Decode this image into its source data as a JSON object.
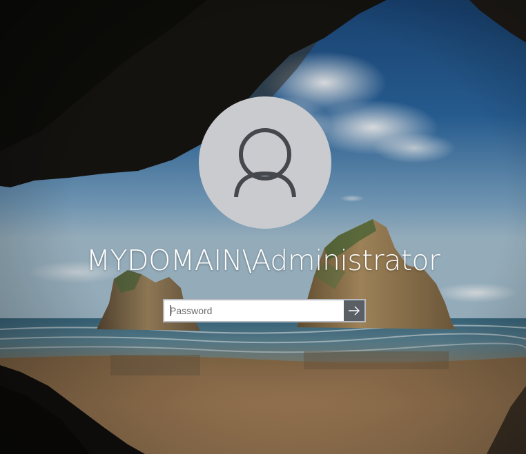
{
  "login": {
    "username": "MYDOMAIN\\Administrator",
    "password_placeholder": "Password",
    "password_value": ""
  },
  "icons": {
    "avatar": "user-silhouette-icon",
    "submit": "arrow-right-icon"
  },
  "colors": {
    "avatar_bg": "#c9cbcf",
    "avatar_glyph": "#44474c",
    "submit_bg": "#5a5f66",
    "text": "#ffffff"
  }
}
